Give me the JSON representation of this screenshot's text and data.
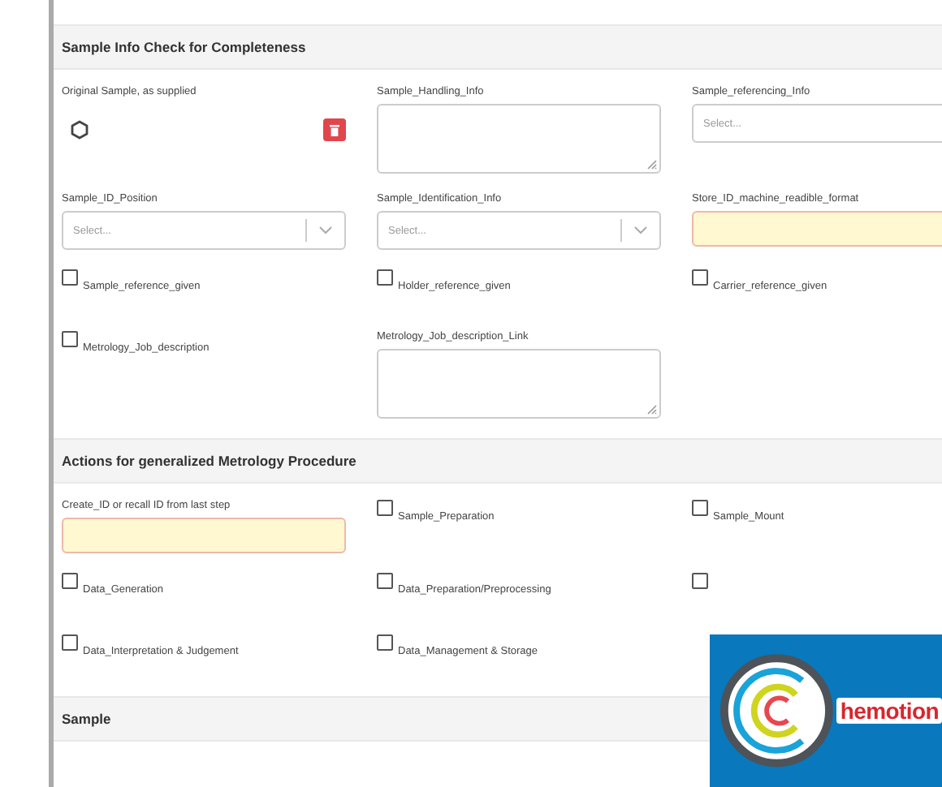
{
  "sections": [
    {
      "title": "Sample Info Check for Completeness",
      "rows": [
        [
          {
            "kind": "structure",
            "label": "Original Sample, as supplied"
          },
          {
            "kind": "textarea",
            "label": "Sample_Handling_Info"
          },
          {
            "kind": "select",
            "label": "Sample_referencing_Info",
            "placeholder": "Select..."
          }
        ],
        [
          {
            "kind": "select",
            "label": "Sample_ID_Position",
            "placeholder": "Select..."
          },
          {
            "kind": "select",
            "label": "Sample_Identification_Info",
            "placeholder": "Select..."
          },
          {
            "kind": "text",
            "label": "Store_ID_machine_readible_format",
            "required": true
          }
        ],
        [
          {
            "kind": "checkbox",
            "label": "Sample_reference_given",
            "checked": false
          },
          {
            "kind": "checkbox",
            "label": "Holder_reference_given",
            "checked": false
          },
          {
            "kind": "checkbox",
            "label": "Carrier_reference_given",
            "checked": false
          }
        ],
        [
          {
            "kind": "checkbox",
            "label": "Metrology_Job_description",
            "checked": false
          },
          {
            "kind": "textarea",
            "label": "Metrology_Job_description_Link"
          }
        ]
      ]
    },
    {
      "title": "Actions for generalized Metrology Procedure",
      "rows": [
        [
          {
            "kind": "text",
            "label": "Create_ID or recall ID from last step",
            "required": true
          },
          {
            "kind": "checkbox",
            "label": "Sample_Preparation",
            "checked": false
          },
          {
            "kind": "checkbox",
            "label": "Sample_Mount",
            "checked": false
          }
        ],
        [
          {
            "kind": "checkbox",
            "label": "Data_Generation",
            "checked": false
          },
          {
            "kind": "checkbox",
            "label": "Data_Preparation/Preprocessing",
            "checked": false
          },
          {
            "kind": "checkbox",
            "checked": false
          }
        ],
        [
          {
            "kind": "checkbox",
            "label": "Data_Interpretation & Judgement",
            "checked": false
          },
          {
            "kind": "checkbox",
            "label": "Data_Management & Storage",
            "checked": false
          }
        ]
      ]
    },
    {
      "title": "Sample"
    }
  ],
  "logo": {
    "text": "hemotion"
  }
}
